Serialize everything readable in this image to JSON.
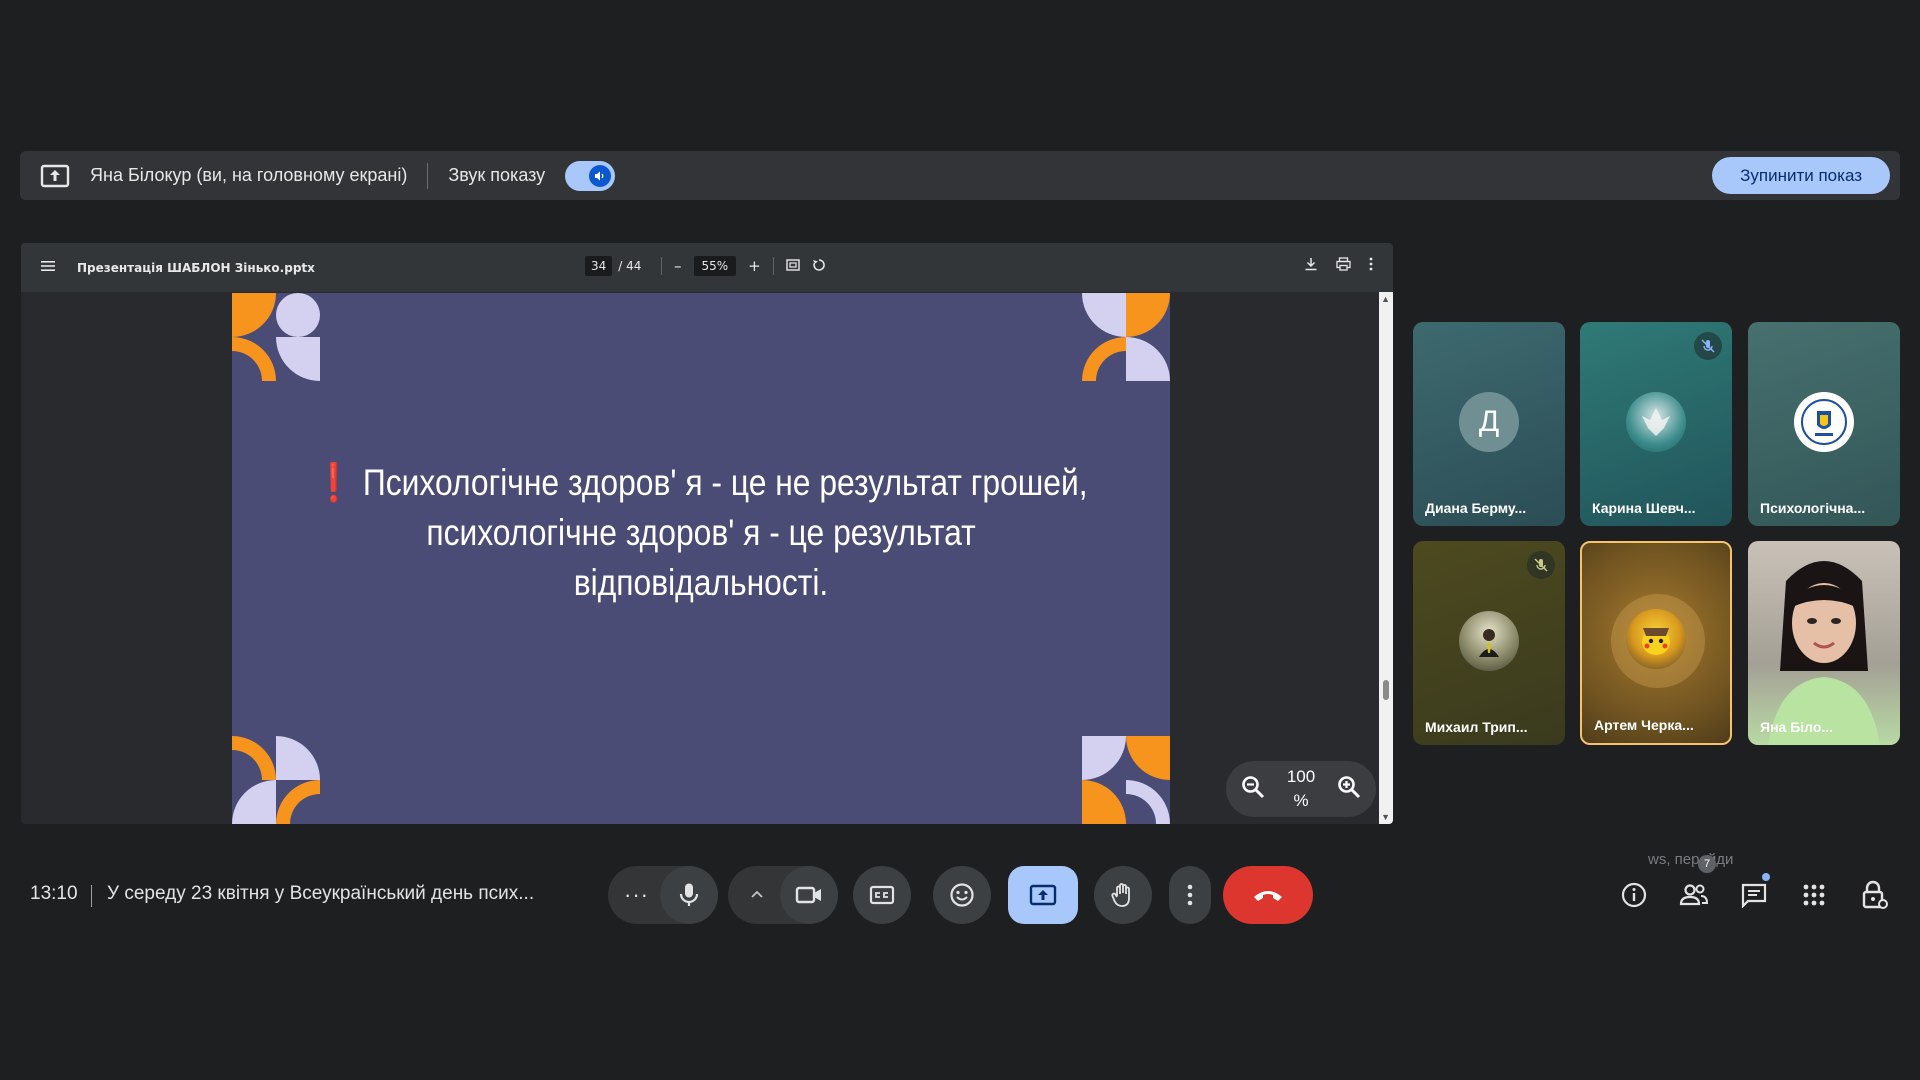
{
  "share_banner": {
    "presenter": "Яна Білокур (ви, на головному екрані)",
    "audio_label": "Звук показу",
    "stop_label": "Зупинити показ"
  },
  "viewer": {
    "file_name": "Презентація ШАБЛОН Зінько.pptx",
    "current_page": "34",
    "total_pages": "/ 44",
    "zoom_percent": "55%",
    "minus": "–",
    "plus": "+"
  },
  "slide": {
    "excl": "❗",
    "line1": "Психологічне здоров' я - це не результат грошей,",
    "line2": "психологічне здоров' я - це результат відповідальності."
  },
  "zoom_overlay": {
    "value": "100 %"
  },
  "participants": [
    {
      "name": "Диана Берму...",
      "initial": "Д",
      "muted": false
    },
    {
      "name": "Карина Шевч...",
      "muted": true
    },
    {
      "name": "Психологічна...",
      "muted": false
    },
    {
      "name": "Михаил Трип...",
      "muted": true
    },
    {
      "name": "Артем Черка...",
      "muted": false
    },
    {
      "name": "Яна Біло...",
      "muted": false
    }
  ],
  "bottom_bar": {
    "time": "13:10",
    "meeting_title": "У середу 23 квітня у Всеукраїнський день псих...",
    "more_dots": "···",
    "people_count": "7",
    "faded_text": "ws, перейди"
  },
  "colors": {
    "slide_bg": "#4b4c75",
    "accent_orange": "#f7941d",
    "accent_lavender": "#d4d0f0",
    "end_call": "#dc362e",
    "share_active": "#a8c7fa",
    "speaking_border": "#f6c26b"
  }
}
